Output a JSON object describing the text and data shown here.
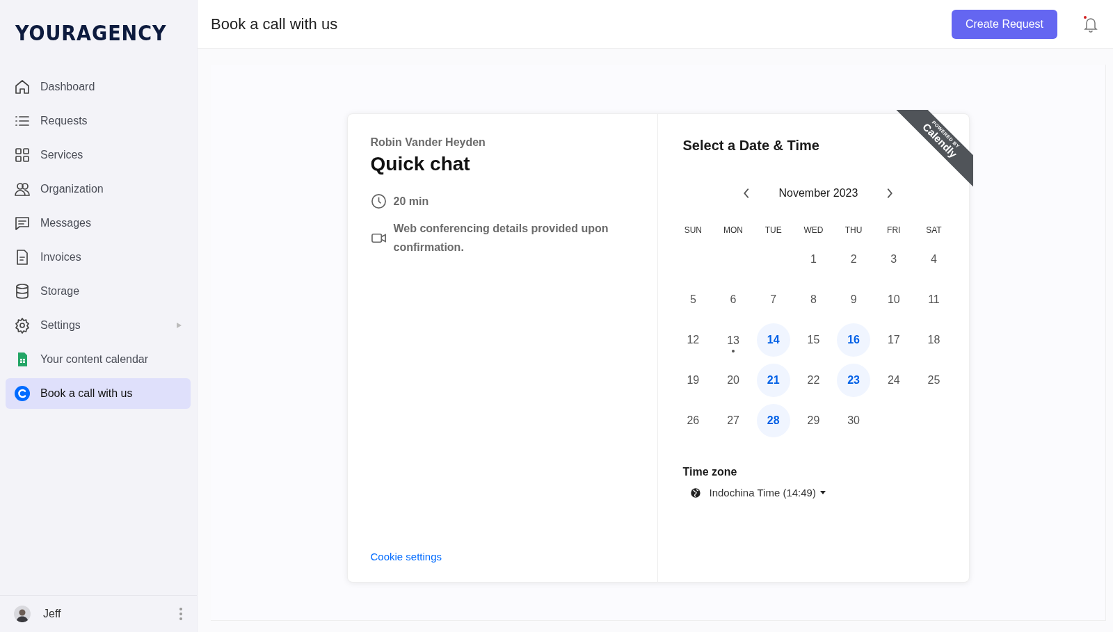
{
  "sidebar": {
    "logo": "YOURAGENCY",
    "items": [
      {
        "label": "Dashboard",
        "selected": false,
        "submenu": false
      },
      {
        "label": "Requests",
        "selected": false,
        "submenu": false
      },
      {
        "label": "Services",
        "selected": false,
        "submenu": false
      },
      {
        "label": "Organization",
        "selected": false,
        "submenu": false
      },
      {
        "label": "Messages",
        "selected": false,
        "submenu": false
      },
      {
        "label": "Invoices",
        "selected": false,
        "submenu": false
      },
      {
        "label": "Storage",
        "selected": false,
        "submenu": false
      },
      {
        "label": "Settings",
        "selected": false,
        "submenu": true
      },
      {
        "label": "Your content calendar",
        "selected": false,
        "submenu": false
      },
      {
        "label": "Book a call with us",
        "selected": true,
        "submenu": false
      }
    ],
    "user": {
      "name": "Jeff"
    }
  },
  "header": {
    "title": "Book a call with us",
    "button": "Create Request",
    "notification": true
  },
  "booking": {
    "host": "Robin Vander Heyden",
    "event": "Quick chat",
    "duration": "20 min",
    "location": "Web conferencing details provided upon confirmation.",
    "cookie_link": "Cookie settings",
    "ribbon": {
      "top": "POWERED BY",
      "brand": "Calendly"
    },
    "heading": "Select a Date & Time",
    "month": "November 2023",
    "weekdays": [
      "SUN",
      "MON",
      "TUE",
      "WED",
      "THU",
      "FRI",
      "SAT"
    ],
    "weeks": [
      [
        {
          "day": "1",
          "available": false,
          "today": false
        },
        {
          "day": "2",
          "available": false,
          "today": false
        },
        {
          "day": "3",
          "available": false,
          "today": false
        },
        {
          "day": "4",
          "available": false,
          "today": false
        }
      ],
      [
        {
          "day": "5",
          "available": false,
          "today": false
        },
        {
          "day": "6",
          "available": false,
          "today": false
        },
        {
          "day": "7",
          "available": false,
          "today": false
        },
        {
          "day": "8",
          "available": false,
          "today": false
        },
        {
          "day": "9",
          "available": false,
          "today": false
        },
        {
          "day": "10",
          "available": false,
          "today": false
        },
        {
          "day": "11",
          "available": false,
          "today": false
        }
      ],
      [
        {
          "day": "12",
          "available": false,
          "today": false
        },
        {
          "day": "13",
          "available": false,
          "today": true
        },
        {
          "day": "14",
          "available": true,
          "today": false
        },
        {
          "day": "15",
          "available": false,
          "today": false
        },
        {
          "day": "16",
          "available": true,
          "today": false
        },
        {
          "day": "17",
          "available": false,
          "today": false
        },
        {
          "day": "18",
          "available": false,
          "today": false
        }
      ],
      [
        {
          "day": "19",
          "available": false,
          "today": false
        },
        {
          "day": "20",
          "available": false,
          "today": false
        },
        {
          "day": "21",
          "available": true,
          "today": false
        },
        {
          "day": "22",
          "available": false,
          "today": false
        },
        {
          "day": "23",
          "available": true,
          "today": false
        },
        {
          "day": "24",
          "available": false,
          "today": false
        },
        {
          "day": "25",
          "available": false,
          "today": false
        }
      ],
      [
        {
          "day": "26",
          "available": false,
          "today": false
        },
        {
          "day": "27",
          "available": false,
          "today": false
        },
        {
          "day": "28",
          "available": true,
          "today": false
        },
        {
          "day": "29",
          "available": false,
          "today": false
        },
        {
          "day": "30",
          "available": false,
          "today": false
        }
      ]
    ],
    "timezone_label": "Time zone",
    "timezone": "Indochina Time (14:49)"
  }
}
